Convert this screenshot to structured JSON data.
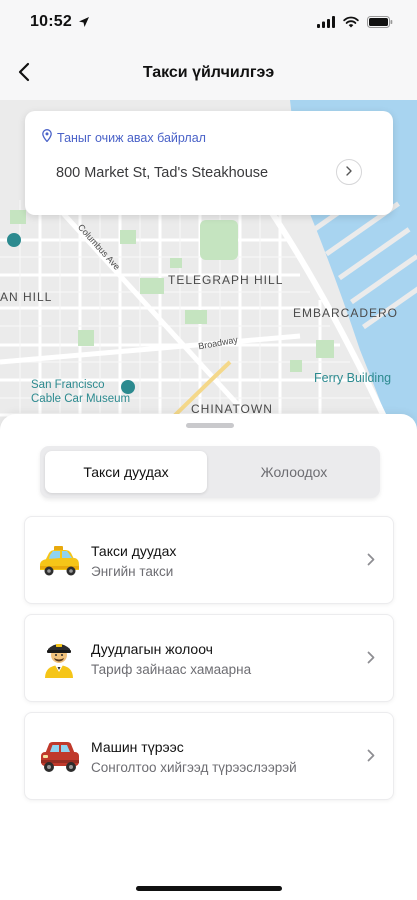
{
  "status_bar": {
    "time": "10:52",
    "icons": [
      "location-arrow-icon",
      "signal-icon",
      "wifi-icon",
      "battery-icon"
    ]
  },
  "nav": {
    "title": "Такси үйлчилгээ",
    "back_icon": "chevron-left-icon"
  },
  "map": {
    "labels": [
      "TELEGRAPH HILL",
      "EMBARCADERO",
      "AN HILL",
      "CHINATOWN",
      "Broadway",
      "Columbus Ave"
    ],
    "pois": [
      {
        "name": "San Francisco Cable Car Museum",
        "line1": "San Francisco",
        "line2": "Cable Car Museum"
      },
      {
        "name": "Ferry Building",
        "line1": "Ferry Building"
      }
    ],
    "colors": {
      "land": "#ebebeb",
      "road": "#ffffff",
      "park": "#c5e4c0",
      "water": "#a8d4f0",
      "highway": "#f4d88a"
    }
  },
  "pickup": {
    "label": "Таныг очиж авах байрлал",
    "address": "800 Market St, Tad's Steakhouse",
    "pin_icon": "map-pin-icon",
    "go_icon": "chevron-right-icon"
  },
  "tabs": {
    "active": "Такси дуудах",
    "inactive": "Жолоодох"
  },
  "options": [
    {
      "title": "Такси дуудах",
      "subtitle": "Энгийн такси",
      "icon": "taxi-car-icon"
    },
    {
      "title": "Дуудлагын жолооч",
      "subtitle": "Тариф зайнаас хамаарна",
      "icon": "driver-icon"
    },
    {
      "title": "Машин түрээс",
      "subtitle": "Сонголтоо хийгээд түрээслээрэй",
      "icon": "rental-car-icon"
    }
  ],
  "theme": {
    "accent": "#4a62c8",
    "taxi_yellow": "#f5c518",
    "rental_red": "#c0392b"
  }
}
